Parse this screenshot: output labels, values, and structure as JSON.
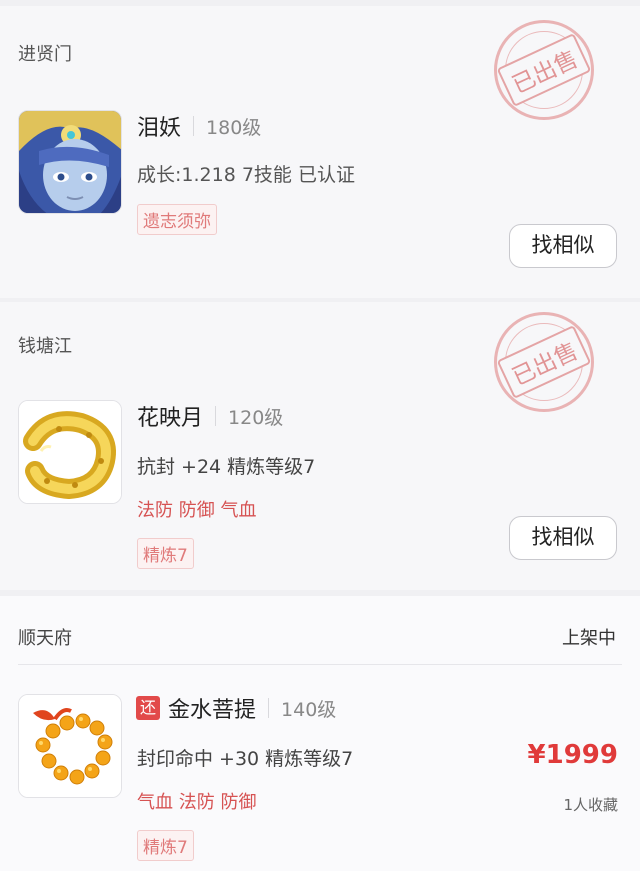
{
  "listings": [
    {
      "server": "进贤门",
      "stamp": "已出售",
      "name": "泪妖",
      "level": "180级",
      "attributes": "成长:1.218 7技能 已认证",
      "chip": "遗志须弥",
      "button": "找相似",
      "image_icon": "pet-portrait-icon"
    },
    {
      "server": "钱塘江",
      "stamp": "已出售",
      "name": "花映月",
      "level": "120级",
      "attributes": "抗封 +24 精炼等级7",
      "props": "法防 防御 气血",
      "chip": "精炼7",
      "button": "找相似",
      "image_icon": "gold-bracelet-icon"
    },
    {
      "server": "顺天府",
      "status": "上架中",
      "badge": "还",
      "name": "金水菩提",
      "level": "140级",
      "attributes": "封印命中 +30 精炼等级7",
      "props": "气血 法防 防御",
      "chip": "精炼7",
      "price": "¥1999",
      "favorites": "1人收藏",
      "image_icon": "prayer-beads-icon"
    }
  ],
  "colors": {
    "accent_red": "#e03a3a",
    "stamp_red": "#d66060",
    "background": "#f0f0f3"
  }
}
